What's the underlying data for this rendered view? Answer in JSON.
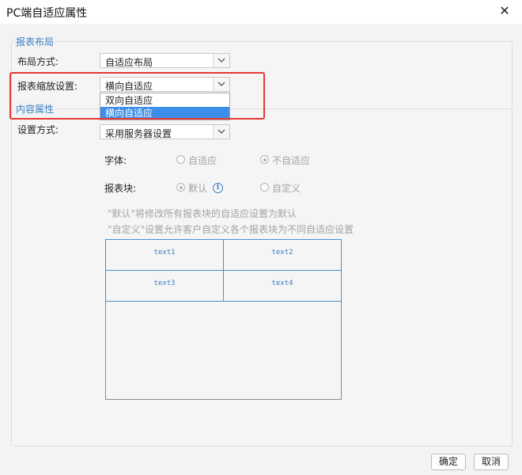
{
  "window": {
    "title": "PC端自适应属性",
    "close_icon": "close-icon"
  },
  "report_layout": {
    "legend": "报表布局",
    "layout_mode_label": "布局方式:",
    "layout_mode_value": "自适应布局",
    "scale_label": "报表缩放设置:",
    "scale_value": "横向自适应",
    "scale_options": [
      "双向自适应",
      "横向自适应"
    ],
    "scale_selected_index": 1
  },
  "content": {
    "legend": "内容属性",
    "setting_label": "设置方式:",
    "setting_value": "采用服务器设置",
    "font_label": "字体:",
    "font_options": [
      "自适应",
      "不自适应"
    ],
    "font_selected_index": 1,
    "block_label": "报表块:",
    "block_options": [
      "默认",
      "自定义"
    ],
    "block_selected_index": 0,
    "desc_line1": "\"默认\"将修改所有报表块的自适应设置为默认",
    "desc_line2": "\"自定义\"设置允许客户自定义各个报表块为不同自适应设置",
    "cells": [
      "text1",
      "text2",
      "text3",
      "text4"
    ]
  },
  "footer": {
    "ok_label": "确定",
    "cancel_label": "取消"
  },
  "colors": {
    "accent": "#3a7ec6",
    "highlight": "#e53935",
    "selected_option": "#3d8ee8"
  }
}
